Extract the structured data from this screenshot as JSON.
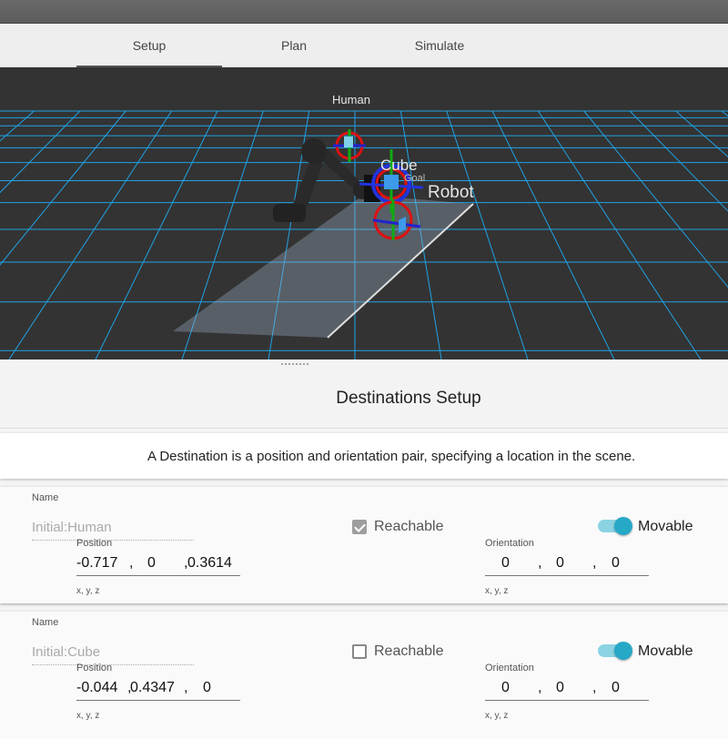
{
  "tabs": [
    "Setup",
    "Plan",
    "Simulate"
  ],
  "viewport": {
    "labels": {
      "human": "Human",
      "cube": "Cube",
      "goal": "Goal",
      "robot": "Robot"
    }
  },
  "section": {
    "title": "Destinations Setup",
    "description": "A Destination is a position and orientation pair, specifying a location in the scene."
  },
  "destinations": [
    {
      "name_label": "Name",
      "name": "Initial:Human",
      "reachable_label": "Reachable",
      "reachable": true,
      "movable_label": "Movable",
      "movable": true,
      "position_label": "Position",
      "position": [
        "-0.717",
        "0",
        "0.3614"
      ],
      "position_hint": "x, y, z",
      "orientation_label": "Orientation",
      "orientation": [
        "0",
        "0",
        "0"
      ],
      "orientation_hint": "x, y, z"
    },
    {
      "name_label": "Name",
      "name": "Initial:Cube",
      "reachable_label": "Reachable",
      "reachable": false,
      "movable_label": "Movable",
      "movable": true,
      "position_label": "Position",
      "position": [
        "-0.044",
        "0.4347",
        "0"
      ],
      "position_hint": "x, y, z",
      "orientation_label": "Orientation",
      "orientation": [
        "0",
        "0",
        "0"
      ],
      "orientation_hint": "x, y, z"
    }
  ],
  "colors": {
    "accent": "#26a8c7",
    "grid": "#1fa3e6",
    "viewport_bg": "#333333"
  }
}
